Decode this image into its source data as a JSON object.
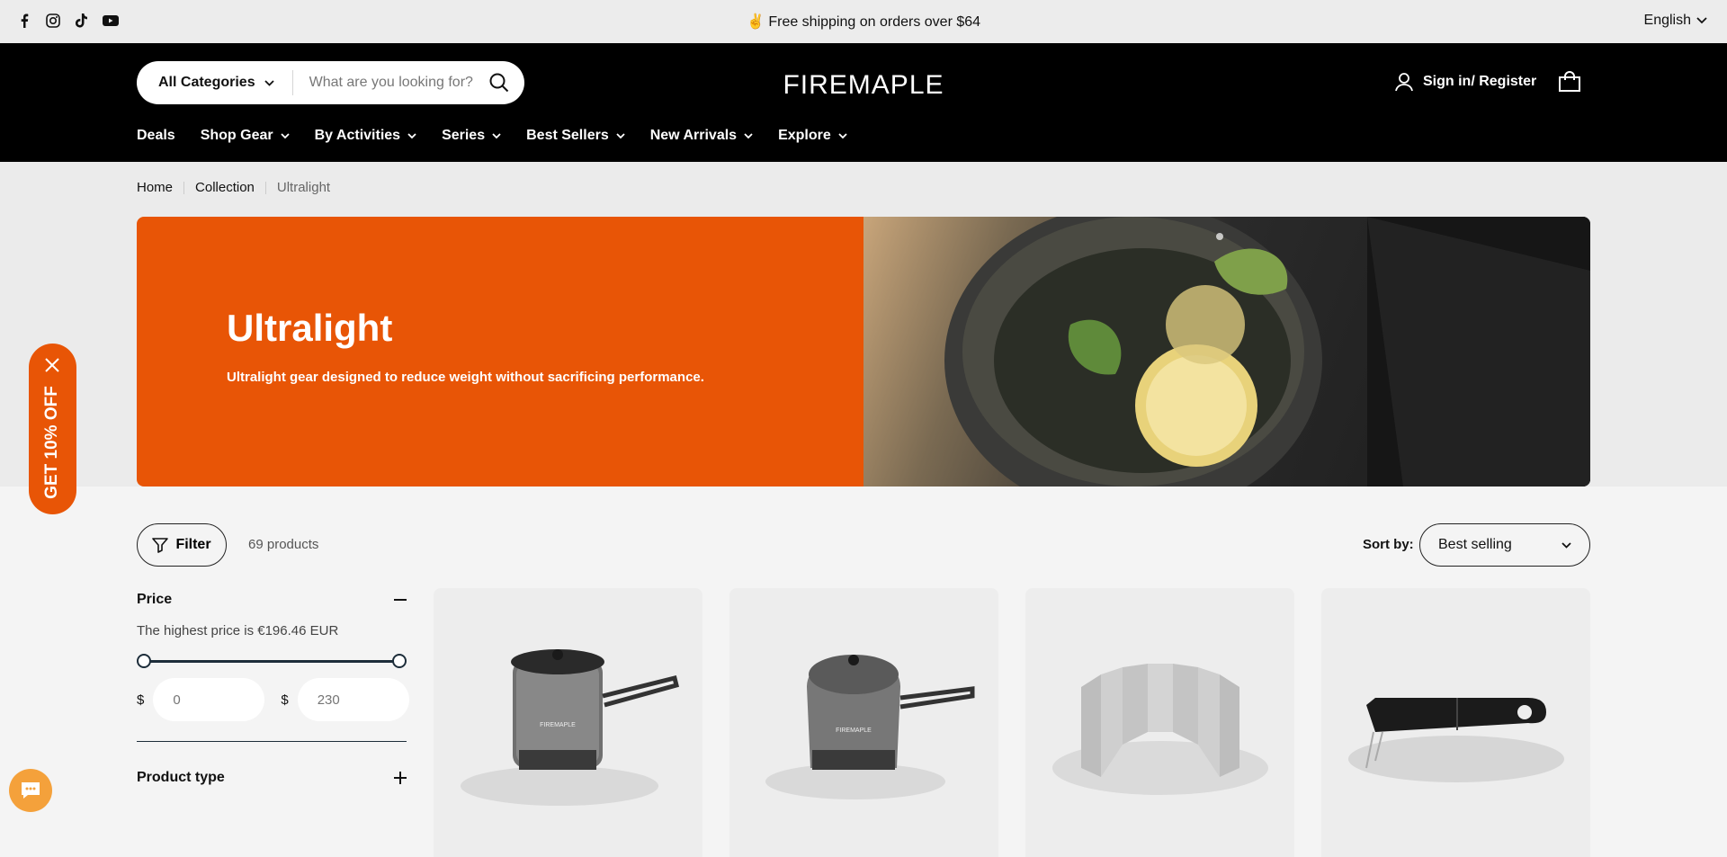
{
  "announcement": {
    "text": "✌ Free shipping on orders over $64",
    "language": "English",
    "social_icons": [
      "facebook-icon",
      "instagram-icon",
      "tiktok-icon",
      "youtube-icon"
    ]
  },
  "header": {
    "search": {
      "category_label": "All Categories",
      "placeholder": "What are you looking for?"
    },
    "logo": "FIREMAPLE",
    "account_label": "Sign in/ Register",
    "nav": [
      {
        "label": "Deals"
      },
      {
        "label": "Shop Gear"
      },
      {
        "label": "By Activities"
      },
      {
        "label": "Series"
      },
      {
        "label": "Best Sellers"
      },
      {
        "label": "New Arrivals"
      },
      {
        "label": "Explore"
      }
    ]
  },
  "breadcrumb": [
    "Home",
    "Collection",
    "Ultralight"
  ],
  "hero": {
    "title": "Ultralight",
    "subtitle": "Ultralight gear designed to reduce weight without sacrificing performance."
  },
  "toolbar": {
    "filter_label": "Filter",
    "product_count": "69 products",
    "sort_label": "Sort by:",
    "sort_value": "Best selling"
  },
  "filters": {
    "price": {
      "title": "Price",
      "note": "The highest price is €196.46 EUR",
      "currency": "$",
      "min_placeholder": "0",
      "max_placeholder": "230"
    },
    "product_type": {
      "title": "Product type"
    }
  },
  "promo": {
    "label": "GET 10% OFF"
  },
  "colors": {
    "accent": "#e85506",
    "header_bg": "#000000",
    "chat": "#f4a13b"
  }
}
